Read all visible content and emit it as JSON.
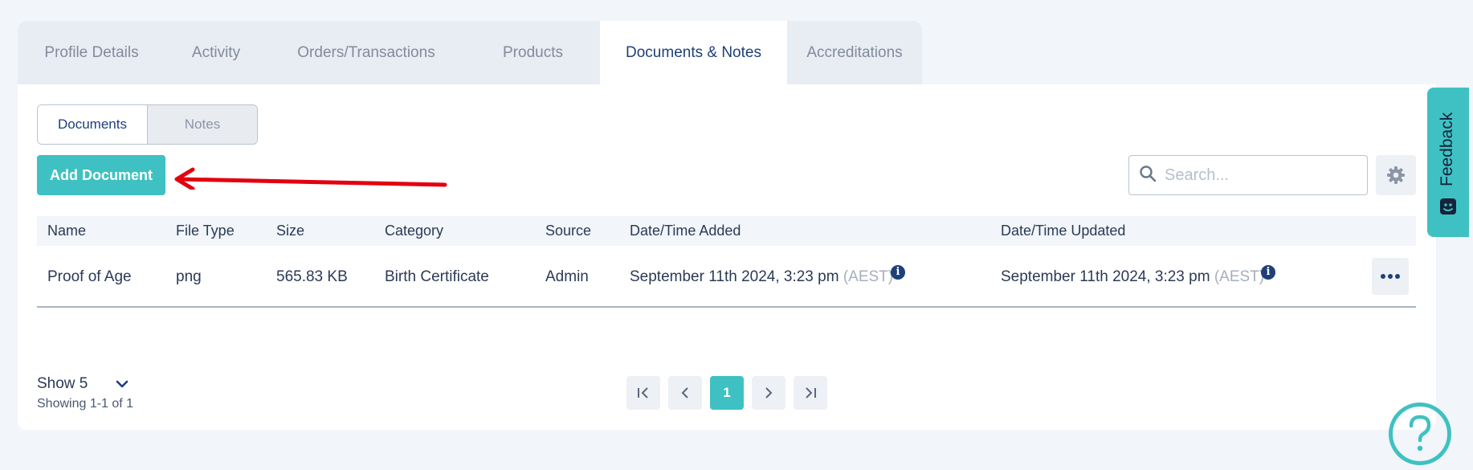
{
  "tabs": [
    {
      "label": "Profile Details"
    },
    {
      "label": "Activity"
    },
    {
      "label": "Orders/Transactions"
    },
    {
      "label": "Products"
    },
    {
      "label": "Documents & Notes"
    },
    {
      "label": "Accreditations"
    }
  ],
  "active_tab": "Documents & Notes",
  "segmented": {
    "documents": "Documents",
    "notes": "Notes"
  },
  "toolbar": {
    "add_document": "Add Document",
    "search_placeholder": "Search..."
  },
  "table": {
    "columns": [
      "Name",
      "File Type",
      "Size",
      "Category",
      "Source",
      "Date/Time Added",
      "Date/Time Updated"
    ],
    "rows": [
      {
        "name": "Proof of Age",
        "file_type": "png",
        "size": "565.83 KB",
        "category": "Birth Certificate",
        "source": "Admin",
        "added": "September 11th 2024, 3:23 pm",
        "added_tz": "(AEST)",
        "updated": "September 11th 2024, 3:23 pm",
        "updated_tz": "(AEST)"
      }
    ]
  },
  "pagination": {
    "show": "Show 5",
    "showing": "Showing 1-1 of 1",
    "current_page": "1"
  },
  "feedback": {
    "label": "Feedback"
  },
  "colors": {
    "accent": "#3fc1c3",
    "navy": "#1f3f7a",
    "arrow": "#e3000f"
  },
  "icons": [
    "search-icon",
    "gear-icon",
    "info-icon",
    "more-icon",
    "chevron-down-icon",
    "first-page-icon",
    "prev-page-icon",
    "next-page-icon",
    "last-page-icon",
    "feedback-icon",
    "help-icon",
    "arrow-annotation"
  ]
}
